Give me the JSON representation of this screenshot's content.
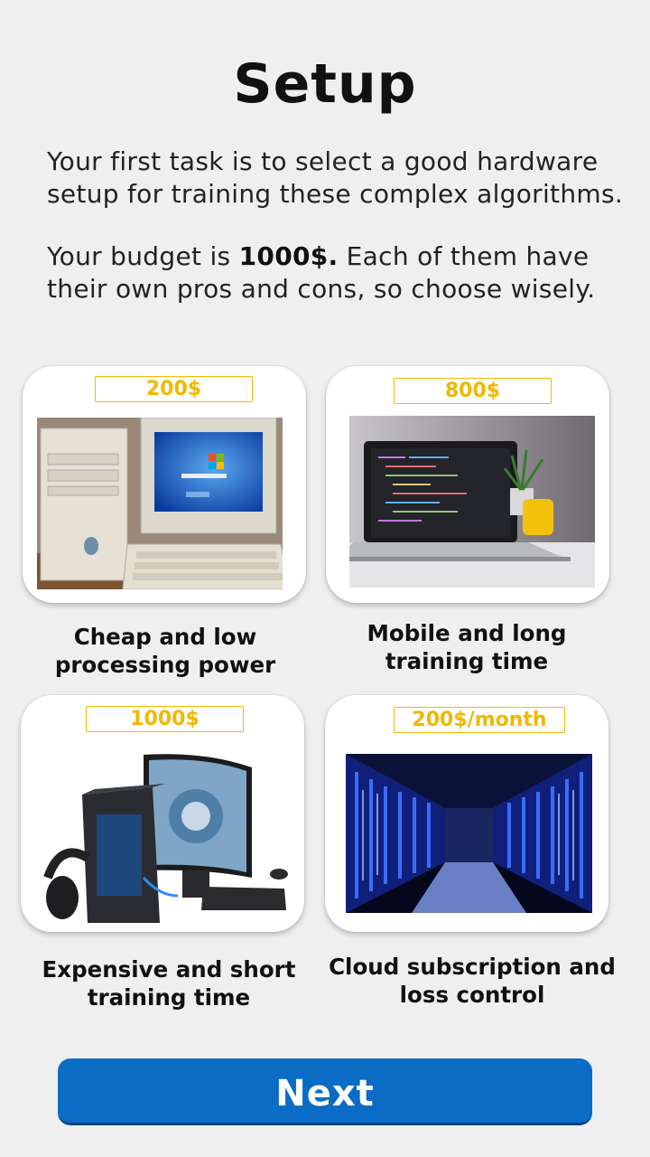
{
  "header": {
    "title": "Setup"
  },
  "intro": {
    "paragraph1": "Your first task is to select a good hardware setup for training these complex algorithms.",
    "budget_prefix": "Your budget is ",
    "budget_amount": "1000$.",
    "budget_suffix": " Each of them have their own pros and cons, so choose wisely."
  },
  "options": [
    {
      "price": "200$",
      "caption": "Cheap and low processing power",
      "image": "old-desktop-computer"
    },
    {
      "price": "800$",
      "caption": "Mobile and long training time",
      "image": "laptop"
    },
    {
      "price": "1000$",
      "caption": "Expensive and short training time",
      "image": "gaming-desktop-pc"
    },
    {
      "price": "200$/month",
      "caption": "Cloud subscription and loss control",
      "image": "data-center-servers"
    }
  ],
  "footer": {
    "next_label": "Next"
  },
  "colors": {
    "accent": "#0a6cc4",
    "price": "#f0b800",
    "background": "#efefef"
  }
}
